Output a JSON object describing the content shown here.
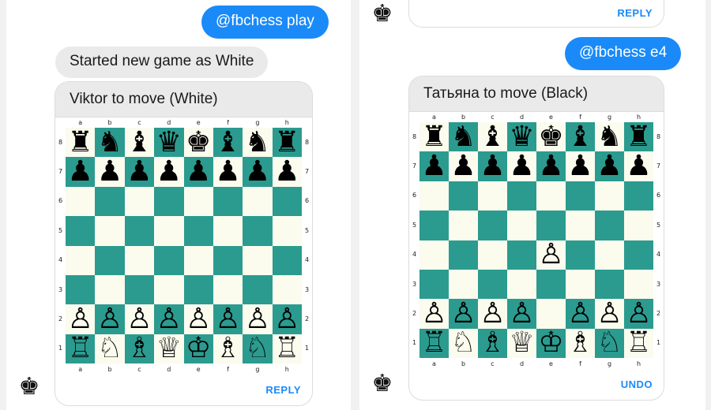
{
  "colors": {
    "accent": "#1a8af8",
    "light_square": "#fbfbee",
    "dark_square": "#2b9b8f"
  },
  "left": {
    "outgoing_message": "@fbchess play",
    "incoming_message": "Started new game as White",
    "card": {
      "header": "Viktor to move (White)",
      "action": "REPLY",
      "board": {
        "files": [
          "a",
          "b",
          "c",
          "d",
          "e",
          "f",
          "g",
          "h"
        ],
        "ranks": [
          "8",
          "7",
          "6",
          "5",
          "4",
          "3",
          "2",
          "1"
        ],
        "rows": [
          [
            "♜",
            "♞",
            "♝",
            "♛",
            "♚",
            "♝",
            "♞",
            "♜"
          ],
          [
            "♟",
            "♟",
            "♟",
            "♟",
            "♟",
            "♟",
            "♟",
            "♟"
          ],
          [
            "",
            "",
            "",
            "",
            "",
            "",
            "",
            ""
          ],
          [
            "",
            "",
            "",
            "",
            "",
            "",
            "",
            ""
          ],
          [
            "",
            "",
            "",
            "",
            "",
            "",
            "",
            ""
          ],
          [
            "",
            "",
            "",
            "",
            "",
            "",
            "",
            ""
          ],
          [
            "♙",
            "♙",
            "♙",
            "♙",
            "♙",
            "♙",
            "♙",
            "♙"
          ],
          [
            "♖",
            "♘",
            "♗",
            "♕",
            "♔",
            "♗",
            "♘",
            "♖"
          ]
        ]
      }
    },
    "avatar_icon": "king-icon"
  },
  "right": {
    "top_card_action": "REPLY",
    "outgoing_message": "@fbchess e4",
    "card": {
      "header": "Татьяна to move (Black)",
      "action": "UNDO",
      "board": {
        "files": [
          "a",
          "b",
          "c",
          "d",
          "e",
          "f",
          "g",
          "h"
        ],
        "ranks": [
          "8",
          "7",
          "6",
          "5",
          "4",
          "3",
          "2",
          "1"
        ],
        "rows": [
          [
            "♜",
            "♞",
            "♝",
            "♛",
            "♚",
            "♝",
            "♞",
            "♜"
          ],
          [
            "♟",
            "♟",
            "♟",
            "♟",
            "♟",
            "♟",
            "♟",
            "♟"
          ],
          [
            "",
            "",
            "",
            "",
            "",
            "",
            "",
            ""
          ],
          [
            "",
            "",
            "",
            "",
            "",
            "",
            "",
            ""
          ],
          [
            "",
            "",
            "",
            "",
            "♙",
            "",
            "",
            ""
          ],
          [
            "",
            "",
            "",
            "",
            "",
            "",
            "",
            ""
          ],
          [
            "♙",
            "♙",
            "♙",
            "♙",
            "",
            "♙",
            "♙",
            "♙"
          ],
          [
            "♖",
            "♘",
            "♗",
            "♕",
            "♔",
            "♗",
            "♘",
            "♖"
          ]
        ]
      }
    },
    "avatar_icon": "king-icon"
  }
}
